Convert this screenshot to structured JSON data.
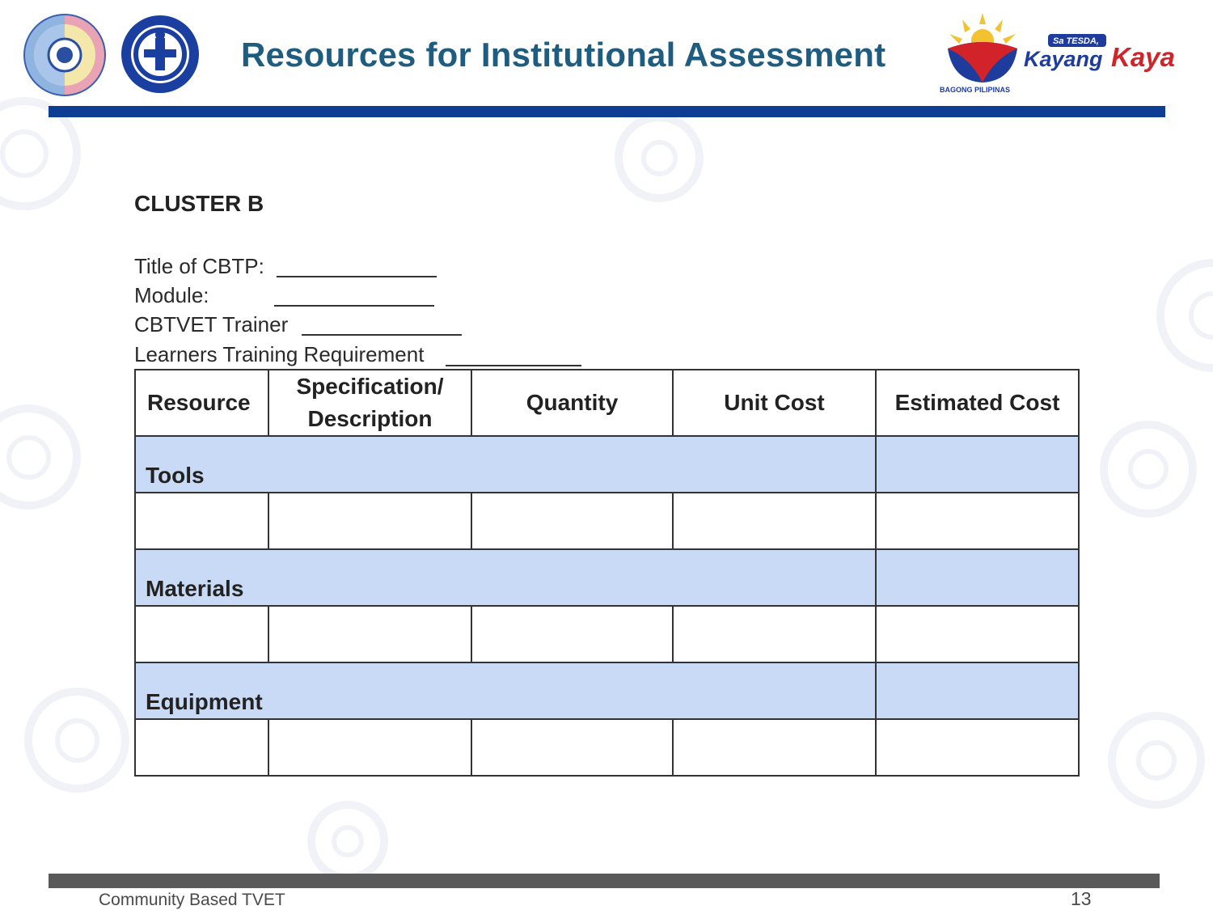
{
  "header": {
    "title": "Resources for Institutional Assessment",
    "logos": {
      "emblem_left": "seal-wheel-icon",
      "tesda_seal": "tesda-seal-icon",
      "bagong_pilipinas": "bagong-pilipinas-logo",
      "bagong_pilipinas_text": "BAGONG PILIPINAS",
      "kayang_kaya": "sa-tesda-kayang-kaya-logo",
      "kayang_kaya_small": "Sa TESDA,",
      "kayang_kaya_main1": "Kayang",
      "kayang_kaya_main2": "Kaya"
    }
  },
  "document": {
    "cluster_label": "CLUSTER B",
    "fields": [
      {
        "label": "Title of CBTP:"
      },
      {
        "label": "Module:"
      },
      {
        "label": "CBTVET Trainer"
      },
      {
        "label": "Learners Training Requirement"
      }
    ],
    "table": {
      "headers": [
        "Resource",
        "Specification/ Description",
        "Quantity",
        "Unit Cost",
        "Estimated Cost"
      ],
      "header_spec_line1": "Specification/",
      "header_spec_line2": "Description",
      "categories": [
        "Tools",
        "Materials",
        "Equipment"
      ]
    }
  },
  "footer": {
    "text": "Community Based TVET",
    "page_number": "13"
  },
  "colors": {
    "title": "#1f5d80",
    "top_rule": "#0d3e94",
    "bottom_rule": "#5a5a5a",
    "category_fill": "#c9daf7"
  }
}
